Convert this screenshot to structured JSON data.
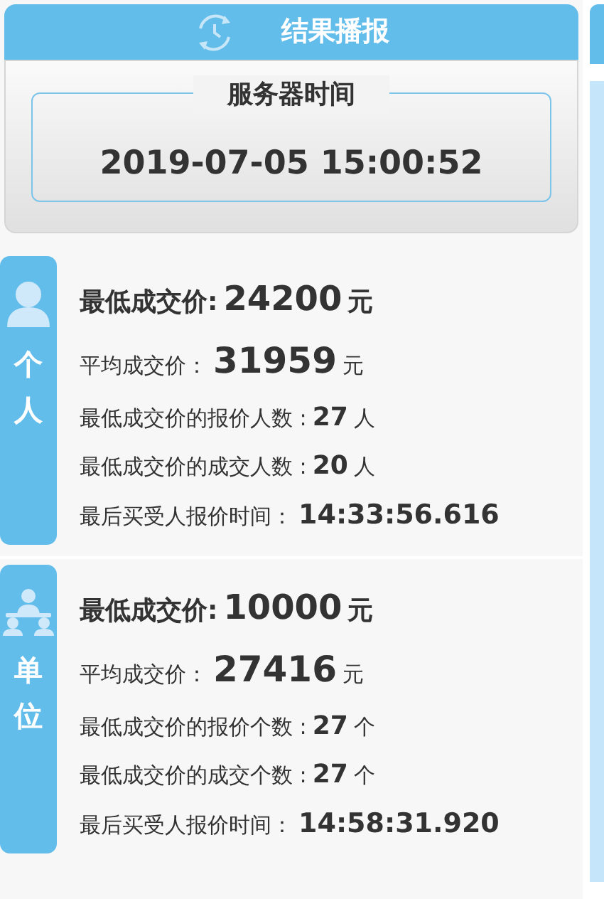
{
  "header": {
    "title": "结果播报"
  },
  "server_time": {
    "label": "服务器时间",
    "value": "2019-07-05 15:00:52"
  },
  "sections": [
    {
      "kind": "person",
      "label": "个人",
      "lines": [
        {
          "kind": "lowest",
          "label": "最低成交价:",
          "value": "24200",
          "unit": "元"
        },
        {
          "kind": "average",
          "label": "平均成交价：",
          "value": "31959",
          "unit": "元"
        },
        {
          "kind": "count",
          "label": "最低成交价的报价人数 :",
          "value": "27",
          "unit": "人"
        },
        {
          "kind": "count",
          "label": "最低成交价的成交人数 :",
          "value": "20",
          "unit": "人"
        },
        {
          "kind": "time",
          "label": "最后买受人报价时间：",
          "value": "14:33:56.616"
        }
      ]
    },
    {
      "kind": "group",
      "label": "单位",
      "lines": [
        {
          "kind": "lowest",
          "label": "最低成交价:",
          "value": "10000",
          "unit": "元"
        },
        {
          "kind": "average",
          "label": "平均成交价：",
          "value": "27416",
          "unit": "元"
        },
        {
          "kind": "count",
          "label": "最低成交价的报价个数 :",
          "value": "27",
          "unit": "个"
        },
        {
          "kind": "count",
          "label": "最低成交价的成交个数 :",
          "value": "27",
          "unit": "个"
        },
        {
          "kind": "time",
          "label": "最后买受人报价时间：",
          "value": "14:58:31.920"
        }
      ]
    }
  ]
}
